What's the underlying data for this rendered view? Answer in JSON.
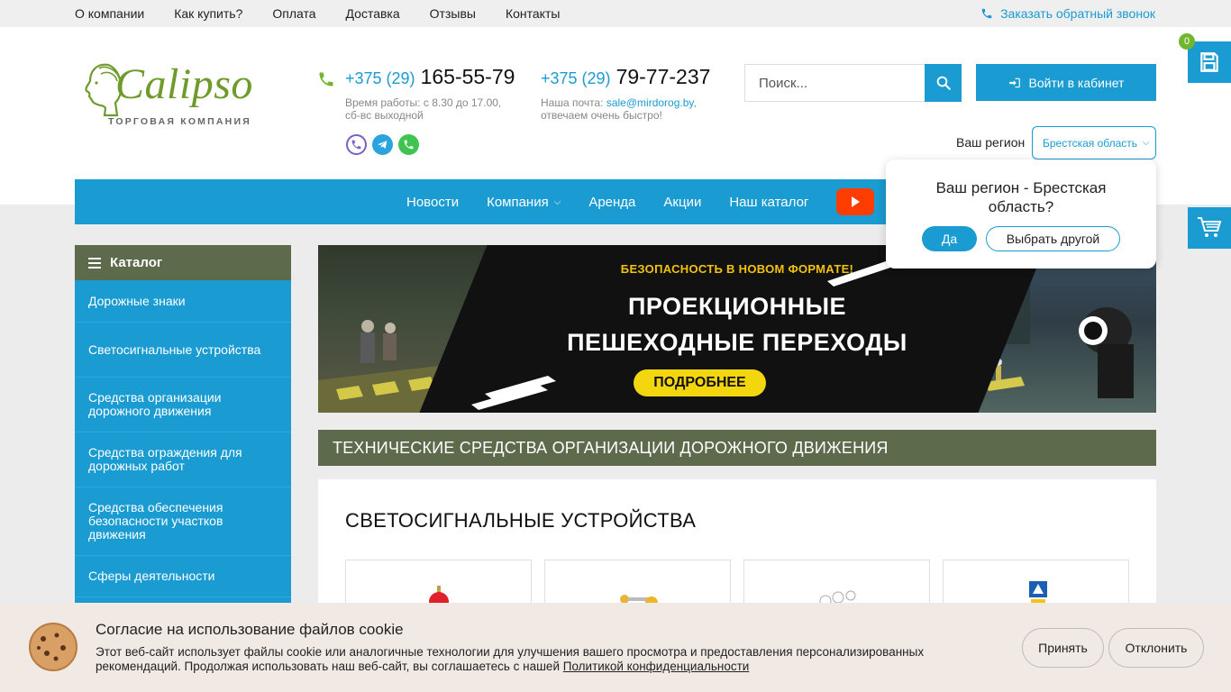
{
  "topnav": {
    "items": [
      "О компании",
      "Как купить?",
      "Оплата",
      "Доставка",
      "Отзывы",
      "Контакты"
    ],
    "callback": "Заказать обратный звонок"
  },
  "logo": {
    "name": "Calipso",
    "subtitle": "ТОРГОВАЯ КОМПАНИЯ"
  },
  "phones": [
    {
      "code": "+375 (29)",
      "number": "165-55-79",
      "note_line1": "Время работы: с 8.30 до 17.00,",
      "note_line2": "сб-вс выходной"
    },
    {
      "code": "+375 (29)",
      "number": "79-77-237",
      "note_prefix": "Наша почта: ",
      "email": "sale@mirdorog.by",
      "note_suffix": ",",
      "note_line2": "отвечаем очень быстро!"
    }
  ],
  "messengers": [
    "viber-icon",
    "telegram-icon",
    "whatsapp-icon"
  ],
  "search": {
    "placeholder": "Поиск..."
  },
  "login": {
    "label": "Войти в кабинет"
  },
  "region": {
    "label": "Ваш регион",
    "selected": "Брестская область"
  },
  "cart": {
    "count": "0"
  },
  "mainnav": {
    "items": [
      "Новости",
      "Компания",
      "Аренда",
      "Акции",
      "Наш каталог"
    ]
  },
  "region_popup": {
    "question": "Ваш регион - Брестская область?",
    "yes": "Да",
    "other": "Выбрать другой"
  },
  "catalog": {
    "title": "Каталог",
    "items": [
      "Дорожные знаки",
      "Светосигнальные устройства",
      "Средства организации дорожного движения",
      "Средства ограждения для дорожных работ",
      "Средства обеспечения безопасности участков движения",
      "Сферы деятельности"
    ]
  },
  "banner": {
    "tag": "БЕЗОПАСНОСТЬ В НОВОМ ФОРМАТЕ!",
    "title_line1": "ПРОЕКЦИОННЫЕ",
    "title_line2": "ПЕШЕХОДНЫЕ ПЕРЕХОДЫ",
    "button": "ПОДРОБНЕЕ"
  },
  "section": {
    "title": "ТЕХНИЧЕСКИЕ СРЕДСТВА ОРГАНИЗАЦИИ ДОРОЖНОГО ДВИЖЕНИЯ",
    "subtitle": "СВЕТОСИГНАЛЬНЫЕ УСТРОЙСТВА"
  },
  "cookie": {
    "title": "Согласие на использование файлов cookie",
    "text": "Этот веб-сайт использует файлы cookie или аналогичные технологии для улучшения вашего просмотра и предоставления персонализированных рекомендаций. Продолжая использовать наш веб-сайт, вы соглашаетесь с нашей ",
    "link": "Политикой конфиденциальности",
    "accept": "Принять",
    "decline": "Отклонить"
  },
  "colors": {
    "accent": "#1a9bd1",
    "olive": "#5d6b4c",
    "logo_green": "#6f9b2c",
    "banner_yellow": "#f3d60e",
    "youtube": "#ff3d00"
  }
}
